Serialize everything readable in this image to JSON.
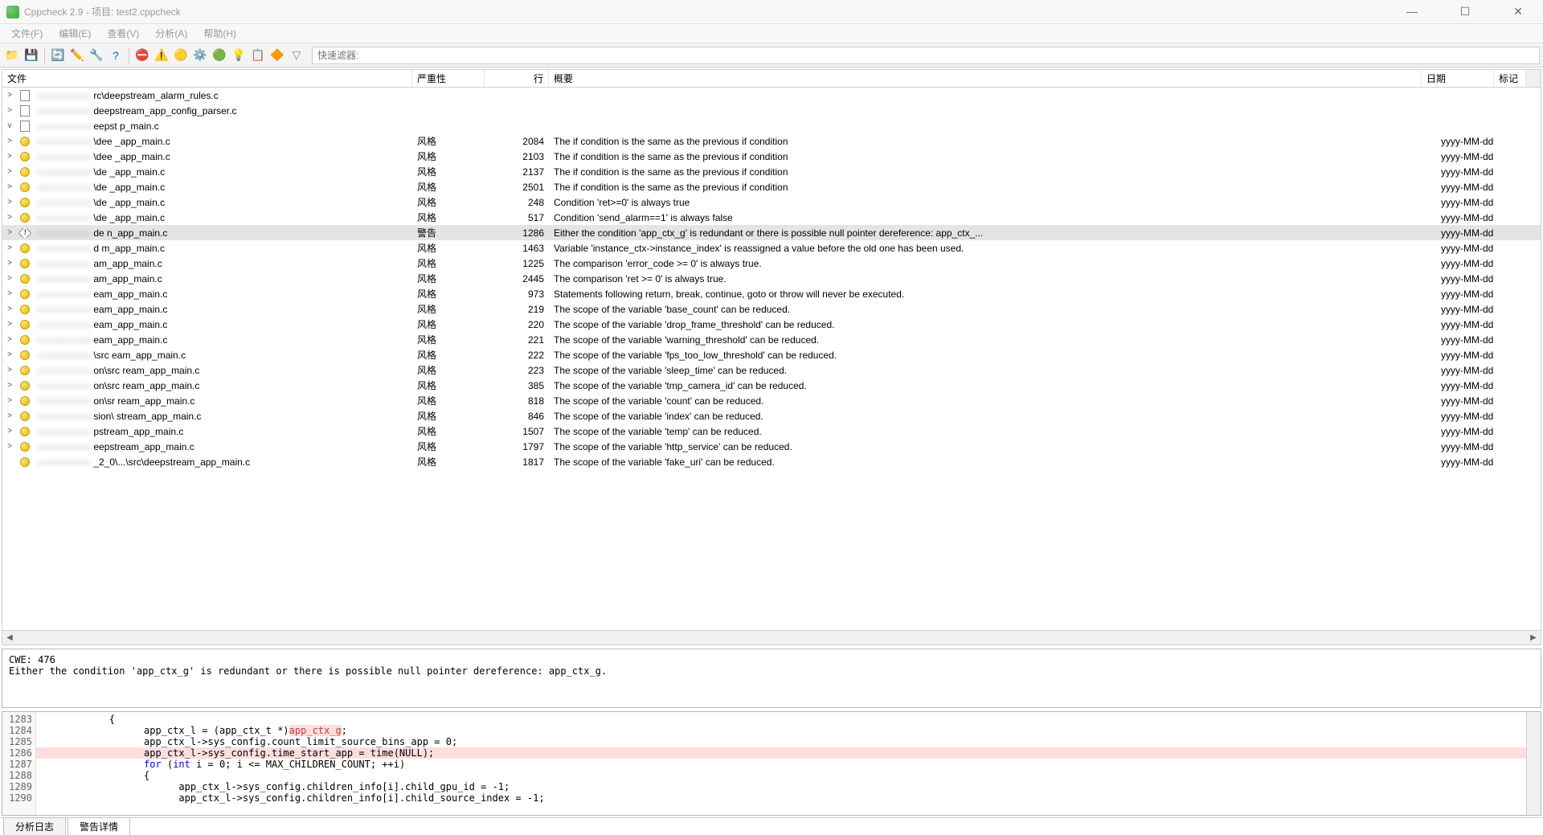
{
  "window": {
    "title": "Cppcheck 2.9 - 项目: test2.cppcheck"
  },
  "menu": {
    "file": "文件(F)",
    "edit": "编辑(E)",
    "view": "查看(V)",
    "analysis": "分析(A)",
    "help": "帮助(H)"
  },
  "toolbar": {
    "filter_placeholder": "快速滤器:"
  },
  "columns": {
    "file": "文件",
    "severity": "严重性",
    "line": "行",
    "summary": "概要",
    "date": "日期",
    "mark": "标记"
  },
  "rows": [
    {
      "exp": ">",
      "icon": "file",
      "file": "rc\\deepstream_alarm_rules.c",
      "sev": "",
      "line": "",
      "sum": "",
      "date": ""
    },
    {
      "exp": ">",
      "icon": "file",
      "file": "deepstream_app_config_parser.c",
      "sev": "",
      "line": "",
      "sum": "",
      "date": ""
    },
    {
      "exp": "v",
      "icon": "file",
      "file": "eepst        p_main.c",
      "sev": "",
      "line": "",
      "sum": "",
      "date": ""
    },
    {
      "exp": ">",
      "icon": "style",
      "file": "\\dee        _app_main.c",
      "sev": "风格",
      "line": "2084",
      "sum": "The if condition is the same as the previous if condition",
      "date": "yyyy-MM-dd"
    },
    {
      "exp": ">",
      "icon": "style",
      "file": "\\dee        _app_main.c",
      "sev": "风格",
      "line": "2103",
      "sum": "The if condition is the same as the previous if condition",
      "date": "yyyy-MM-dd"
    },
    {
      "exp": ">",
      "icon": "style",
      "file": "\\de          _app_main.c",
      "sev": "风格",
      "line": "2137",
      "sum": "The if condition is the same as the previous if condition",
      "date": "yyyy-MM-dd"
    },
    {
      "exp": ">",
      "icon": "style",
      "file": "\\de          _app_main.c",
      "sev": "风格",
      "line": "2501",
      "sum": "The if condition is the same as the previous if condition",
      "date": "yyyy-MM-dd"
    },
    {
      "exp": ">",
      "icon": "style",
      "file": "\\de          _app_main.c",
      "sev": "风格",
      "line": "248",
      "sum": "Condition 'ret>=0' is always true",
      "date": "yyyy-MM-dd"
    },
    {
      "exp": ">",
      "icon": "style",
      "file": "\\de          _app_main.c",
      "sev": "风格",
      "line": "517",
      "sum": "Condition 'send_alarm==1' is always false",
      "date": "yyyy-MM-dd"
    },
    {
      "exp": ">",
      "icon": "warn",
      "file": "de         n_app_main.c",
      "sev": "警告",
      "line": "1286",
      "sum": "Either the condition 'app_ctx_g' is redundant or there is possible null pointer dereference: app_ctx_...",
      "date": "yyyy-MM-dd",
      "sel": true
    },
    {
      "exp": ">",
      "icon": "style",
      "file": "d          m_app_main.c",
      "sev": "风格",
      "line": "1463",
      "sum": "Variable 'instance_ctx->instance_index' is reassigned a value before the old one has been used.",
      "date": "yyyy-MM-dd"
    },
    {
      "exp": ">",
      "icon": "style",
      "file": "am_app_main.c",
      "sev": "风格",
      "line": "1225",
      "sum": "The comparison 'error_code >= 0' is always true.",
      "date": "yyyy-MM-dd"
    },
    {
      "exp": ">",
      "icon": "style",
      "file": "am_app_main.c",
      "sev": "风格",
      "line": "2445",
      "sum": "The comparison 'ret >= 0' is always true.",
      "date": "yyyy-MM-dd"
    },
    {
      "exp": ">",
      "icon": "style",
      "file": "eam_app_main.c",
      "sev": "风格",
      "line": "973",
      "sum": "Statements following return, break, continue, goto or throw will never be executed.",
      "date": "yyyy-MM-dd"
    },
    {
      "exp": ">",
      "icon": "style",
      "file": "eam_app_main.c",
      "sev": "风格",
      "line": "219",
      "sum": "The scope of the variable 'base_count' can be reduced.",
      "date": "yyyy-MM-dd"
    },
    {
      "exp": ">",
      "icon": "style",
      "file": "eam_app_main.c",
      "sev": "风格",
      "line": "220",
      "sum": "The scope of the variable 'drop_frame_threshold' can be reduced.",
      "date": "yyyy-MM-dd"
    },
    {
      "exp": ">",
      "icon": "style",
      "file": "eam_app_main.c",
      "sev": "风格",
      "line": "221",
      "sum": "The scope of the variable 'warning_threshold' can be reduced.",
      "date": "yyyy-MM-dd"
    },
    {
      "exp": ">",
      "icon": "style",
      "file": "\\src        eam_app_main.c",
      "sev": "风格",
      "line": "222",
      "sum": "The scope of the variable 'fps_too_low_threshold' can be reduced.",
      "date": "yyyy-MM-dd"
    },
    {
      "exp": ">",
      "icon": "style",
      "file": "on\\src      ream_app_main.c",
      "sev": "风格",
      "line": "223",
      "sum": "The scope of the variable 'sleep_time' can be reduced.",
      "date": "yyyy-MM-dd"
    },
    {
      "exp": ">",
      "icon": "style",
      "file": "on\\src      ream_app_main.c",
      "sev": "风格",
      "line": "385",
      "sum": "The scope of the variable 'tmp_camera_id' can be reduced.",
      "date": "yyyy-MM-dd"
    },
    {
      "exp": ">",
      "icon": "style",
      "file": "on\\sr       ream_app_main.c",
      "sev": "风格",
      "line": "818",
      "sum": "The scope of the variable 'count' can be reduced.",
      "date": "yyyy-MM-dd"
    },
    {
      "exp": ">",
      "icon": "style",
      "file": "sion\\        stream_app_main.c",
      "sev": "风格",
      "line": "846",
      "sum": "The scope of the variable 'index' can be reduced.",
      "date": "yyyy-MM-dd"
    },
    {
      "exp": ">",
      "icon": "style",
      "file": "pstream_app_main.c",
      "sev": "风格",
      "line": "1507",
      "sum": "The scope of the variable 'temp' can be reduced.",
      "date": "yyyy-MM-dd"
    },
    {
      "exp": ">",
      "icon": "style",
      "file": "eepstream_app_main.c",
      "sev": "风格",
      "line": "1797",
      "sum": "The scope of the variable 'http_service' can be reduced.",
      "date": "yyyy-MM-dd"
    },
    {
      "exp": "",
      "icon": "style",
      "file": "_2_0\\...\\src\\deepstream_app_main.c",
      "sev": "风格",
      "line": "1817",
      "sum": "The scope of the variable 'fake_uri' can be reduced.",
      "date": "yyyy-MM-dd"
    }
  ],
  "detail": {
    "cwe": "CWE: 476",
    "msg": "Either the condition 'app_ctx_g' is redundant or there is possible null pointer dereference: app_ctx_g."
  },
  "code": {
    "lines": [
      {
        "n": "1283",
        "t": "            {",
        "hl": false
      },
      {
        "n": "1284",
        "t": "                  app_ctx_l = (app_ctx_t *)",
        "tail_hl": "app_ctx_g",
        "tail2": ";",
        "hl": false
      },
      {
        "n": "1285",
        "t": "                  app_ctx_l->sys_config.count_limit_source_bins_app = 0;",
        "hl": false
      },
      {
        "n": "1286",
        "t": "                  app_ctx_l->sys_config.time_start_app = time(NULL);",
        "hl": true
      },
      {
        "n": "1287",
        "kw": "                  for ",
        "paren": "(",
        "kw2": "int",
        "mid": " i = 0; i <= MAX_CHILDREN_COUNT; ++i)",
        "hl": false
      },
      {
        "n": "1288",
        "t": "                  {",
        "hl": false
      },
      {
        "n": "1289",
        "t": "                        app_ctx_l->sys_config.children_info[i].child_gpu_id = -1;",
        "hl": false
      },
      {
        "n": "1290",
        "t": "                        app_ctx_l->sys_config.children_info[i].child_source_index = -1;",
        "hl": false
      }
    ]
  },
  "tabs": {
    "log": "分析日志",
    "detail": "警告详情"
  }
}
